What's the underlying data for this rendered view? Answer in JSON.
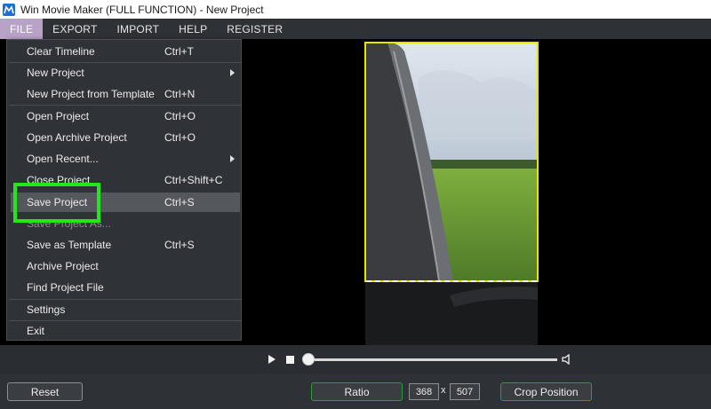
{
  "window": {
    "title": "Win Movie Maker (FULL FUNCTION) - New Project",
    "icon": "app-logo-icon"
  },
  "menubar": {
    "items": [
      "FILE",
      "EXPORT",
      "IMPORT",
      "HELP",
      "REGISTER"
    ],
    "active": "FILE"
  },
  "file_menu": {
    "items": [
      {
        "label": "Clear Timeline",
        "shortcut": "Ctrl+T"
      },
      {
        "label": "New Project",
        "shortcut": "",
        "submenu": true
      },
      {
        "label": "New Project from Template",
        "shortcut": "Ctrl+N"
      },
      {
        "label": "Open Project",
        "shortcut": "Ctrl+O"
      },
      {
        "label": "Open Archive Project",
        "shortcut": "Ctrl+O"
      },
      {
        "label": "Open Recent...",
        "shortcut": "",
        "submenu": true
      },
      {
        "label": "Close Project",
        "shortcut": "Ctrl+Shift+C"
      },
      {
        "label": "Save Project",
        "shortcut": "Ctrl+S",
        "highlighted": true
      },
      {
        "label": "Save Project As...",
        "shortcut": "",
        "disabled": true
      },
      {
        "label": "Save as Template",
        "shortcut": "Ctrl+S"
      },
      {
        "label": "Archive Project",
        "shortcut": ""
      },
      {
        "label": "Find Project File",
        "shortcut": ""
      },
      {
        "label": "Settings",
        "shortcut": ""
      },
      {
        "label": "Exit",
        "shortcut": ""
      }
    ]
  },
  "player": {
    "play_icon": "play-icon",
    "stop_icon": "stop-icon",
    "volume_icon": "volume-icon",
    "progress": 0
  },
  "crop_bar": {
    "reset_label": "Reset",
    "ratio_label": "Ratio",
    "width": "368",
    "separator": "x",
    "height": "507",
    "crop_position_label": "Crop Position"
  },
  "colors": {
    "highlight_box": "#22e81a",
    "crop_frame": "#e8e600",
    "active_menu": "#b8a2c8"
  }
}
